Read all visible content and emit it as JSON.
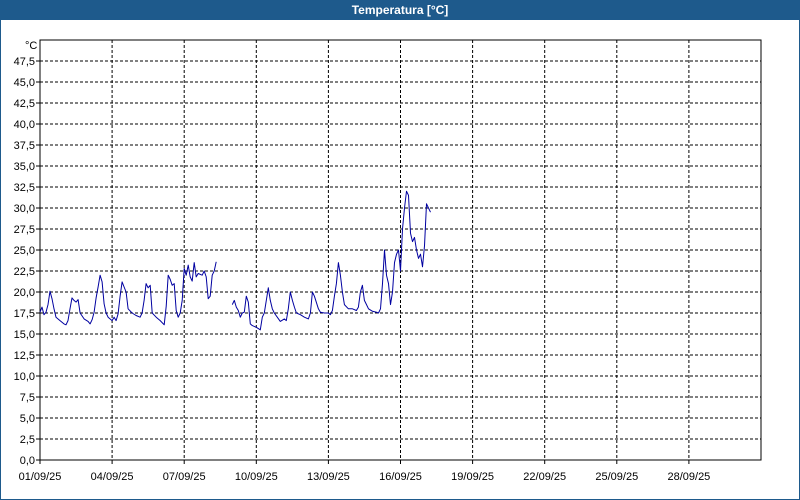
{
  "window": {
    "title": "Temperatura [°C]"
  },
  "colors": {
    "title_bar": "#1e5a8c",
    "series": "#0000a0",
    "grid": "#000000"
  },
  "chart_data": {
    "type": "line",
    "title": "Temperatura [°C]",
    "ylabel": "°C",
    "xlabel": "",
    "ylim": [
      0,
      50
    ],
    "xlim": [
      "01/09/25",
      "01/10/25"
    ],
    "grid": true,
    "grid_style": "dashed",
    "y_ticks": [
      0,
      2.5,
      5,
      7.5,
      10,
      12.5,
      15,
      17.5,
      20,
      22.5,
      25,
      27.5,
      30,
      32.5,
      35,
      37.5,
      40,
      42.5,
      45,
      47.5
    ],
    "y_tick_labels": [
      "0,0",
      "2,5",
      "5,0",
      "7,5",
      "10,0",
      "12,5",
      "15,0",
      "17,5",
      "20,0",
      "22,5",
      "25,0",
      "27,5",
      "30,0",
      "32,5",
      "35,0",
      "37,5",
      "40,0",
      "42,5",
      "45,0",
      "47,5"
    ],
    "x_ticks": [
      "01/09/25",
      "04/09/25",
      "07/09/25",
      "10/09/25",
      "13/09/25",
      "16/09/25",
      "19/09/25",
      "22/09/25",
      "25/09/25",
      "28/09/25"
    ],
    "x_tick_labels": [
      "01/09/25",
      "04/09/25",
      "07/09/25",
      "10/09/25",
      "13/09/25",
      "16/09/25",
      "19/09/25",
      "22/09/25",
      "25/09/25",
      "28/09/25"
    ],
    "series": [
      {
        "segments": [
          [
            [
              "01/09/25 00:00",
              17.6
            ],
            [
              "01/09/25 02:00",
              18.2
            ],
            [
              "01/09/25 04:00",
              17.3
            ],
            [
              "01/09/25 06:00",
              17.6
            ],
            [
              "01/09/25 08:00",
              18.5
            ],
            [
              "01/09/25 10:00",
              20.1
            ],
            [
              "01/09/25 12:00",
              19.2
            ],
            [
              "01/09/25 14:00",
              18.0
            ],
            [
              "01/09/25 16:00",
              17.0
            ],
            [
              "01/09/25 20:00",
              16.6
            ],
            [
              "02/09/25 00:00",
              16.2
            ],
            [
              "02/09/25 02:00",
              16.1
            ],
            [
              "02/09/25 04:00",
              16.6
            ],
            [
              "02/09/25 06:00",
              18.0
            ],
            [
              "02/09/25 08:00",
              19.3
            ],
            [
              "02/09/25 10:00",
              19.0
            ],
            [
              "02/09/25 12:00",
              18.8
            ],
            [
              "02/09/25 14:00",
              19.1
            ],
            [
              "02/09/25 16:00",
              17.5
            ],
            [
              "02/09/25 20:00",
              16.8
            ],
            [
              "03/09/25 00:00",
              16.5
            ],
            [
              "03/09/25 02:00",
              16.2
            ],
            [
              "03/09/25 04:00",
              16.7
            ],
            [
              "03/09/25 06:00",
              17.6
            ],
            [
              "03/09/25 08:00",
              19.3
            ],
            [
              "03/09/25 10:00",
              20.6
            ],
            [
              "03/09/25 12:00",
              22.0
            ],
            [
              "03/09/25 14:00",
              21.2
            ],
            [
              "03/09/25 16:00",
              18.6
            ],
            [
              "03/09/25 18:00",
              17.5
            ],
            [
              "03/09/25 20:00",
              17.0
            ],
            [
              "04/09/25 00:00",
              16.6
            ],
            [
              "04/09/25 02:00",
              17.0
            ],
            [
              "04/09/25 04:00",
              16.6
            ],
            [
              "04/09/25 06:00",
              17.4
            ],
            [
              "04/09/25 08:00",
              19.5
            ],
            [
              "04/09/25 10:00",
              21.2
            ],
            [
              "04/09/25 12:00",
              20.6
            ],
            [
              "04/09/25 14:00",
              20.0
            ],
            [
              "04/09/25 16:00",
              18.0
            ],
            [
              "04/09/25 20:00",
              17.5
            ],
            [
              "05/09/25 00:00",
              17.2
            ],
            [
              "05/09/25 04:00",
              17.0
            ],
            [
              "05/09/25 06:00",
              17.5
            ],
            [
              "05/09/25 08:00",
              19.0
            ],
            [
              "05/09/25 10:00",
              21.0
            ],
            [
              "05/09/25 12:00",
              20.5
            ],
            [
              "05/09/25 14:00",
              20.8
            ],
            [
              "05/09/25 16:00",
              17.5
            ],
            [
              "05/09/25 20:00",
              17.0
            ],
            [
              "06/09/25 00:00",
              16.6
            ],
            [
              "06/09/25 04:00",
              16.1
            ],
            [
              "06/09/25 06:00",
              18.3
            ],
            [
              "06/09/25 08:00",
              22.0
            ],
            [
              "06/09/25 10:00",
              21.5
            ],
            [
              "06/09/25 12:00",
              20.8
            ],
            [
              "06/09/25 14:00",
              21.0
            ],
            [
              "06/09/25 16:00",
              17.8
            ],
            [
              "06/09/25 18:00",
              17.0
            ],
            [
              "06/09/25 20:00",
              17.5
            ],
            [
              "06/09/25 22:00",
              19.0
            ],
            [
              "07/09/25 00:00",
              22.8
            ],
            [
              "07/09/25 02:00",
              22.0
            ],
            [
              "07/09/25 04:00",
              23.2
            ],
            [
              "07/09/25 06:00",
              21.8
            ],
            [
              "07/09/25 08:00",
              21.3
            ],
            [
              "07/09/25 10:00",
              23.5
            ],
            [
              "07/09/25 12:00",
              21.8
            ],
            [
              "07/09/25 14:00",
              22.2
            ],
            [
              "07/09/25 18:00",
              22.0
            ],
            [
              "07/09/25 20:00",
              22.5
            ],
            [
              "07/09/25 22:00",
              21.8
            ],
            [
              "08/09/25 00:00",
              19.2
            ],
            [
              "08/09/25 02:00",
              19.5
            ],
            [
              "08/09/25 04:00",
              22.0
            ],
            [
              "08/09/25 06:00",
              22.5
            ],
            [
              "08/09/25 08:00",
              23.6
            ]
          ],
          [
            [
              "09/09/25 00:00",
              18.5
            ],
            [
              "09/09/25 02:00",
              19.0
            ],
            [
              "09/09/25 04:00",
              18.2
            ],
            [
              "09/09/25 06:00",
              17.8
            ],
            [
              "09/09/25 08:00",
              17.0
            ],
            [
              "09/09/25 10:00",
              17.5
            ],
            [
              "09/09/25 12:00",
              17.6
            ],
            [
              "09/09/25 14:00",
              19.5
            ],
            [
              "09/09/25 16:00",
              18.8
            ],
            [
              "09/09/25 18:00",
              16.2
            ],
            [
              "09/09/25 20:00",
              16.0
            ],
            [
              "10/09/25 00:00",
              15.8
            ],
            [
              "10/09/25 04:00",
              15.5
            ],
            [
              "10/09/25 06:00",
              17.0
            ],
            [
              "10/09/25 08:00",
              17.5
            ],
            [
              "10/09/25 10:00",
              19.0
            ],
            [
              "10/09/25 12:00",
              20.5
            ],
            [
              "10/09/25 14:00",
              19.0
            ],
            [
              "10/09/25 16:00",
              18.0
            ],
            [
              "10/09/25 18:00",
              17.5
            ],
            [
              "11/09/25 00:00",
              16.5
            ],
            [
              "11/09/25 04:00",
              16.8
            ],
            [
              "11/09/25 06:00",
              16.6
            ],
            [
              "11/09/25 08:00",
              18.0
            ],
            [
              "11/09/25 10:00",
              20.0
            ],
            [
              "11/09/25 12:00",
              19.0
            ],
            [
              "11/09/25 14:00",
              18.2
            ],
            [
              "11/09/25 16:00",
              17.5
            ],
            [
              "11/09/25 20:00",
              17.3
            ],
            [
              "12/09/25 00:00",
              17.0
            ],
            [
              "12/09/25 04:00",
              16.8
            ],
            [
              "12/09/25 06:00",
              17.5
            ],
            [
              "12/09/25 08:00",
              20.0
            ],
            [
              "12/09/25 10:00",
              19.5
            ],
            [
              "12/09/25 14:00",
              18.0
            ],
            [
              "12/09/25 16:00",
              17.6
            ],
            [
              "12/09/25 20:00",
              17.5
            ],
            [
              "13/09/25 00:00",
              17.5
            ],
            [
              "13/09/25 02:00",
              17.3
            ],
            [
              "13/09/25 04:00",
              17.8
            ],
            [
              "13/09/25 06:00",
              19.5
            ],
            [
              "13/09/25 08:00",
              21.0
            ],
            [
              "13/09/25 10:00",
              23.5
            ],
            [
              "13/09/25 12:00",
              22.0
            ],
            [
              "13/09/25 14:00",
              20.0
            ],
            [
              "13/09/25 16:00",
              18.5
            ],
            [
              "13/09/25 20:00",
              18.0
            ],
            [
              "14/09/25 00:00",
              18.0
            ],
            [
              "14/09/25 04:00",
              17.8
            ],
            [
              "14/09/25 06:00",
              18.2
            ],
            [
              "14/09/25 08:00",
              20.0
            ],
            [
              "14/09/25 10:00",
              20.8
            ],
            [
              "14/09/25 12:00",
              19.0
            ],
            [
              "14/09/25 14:00",
              18.5
            ],
            [
              "14/09/25 16:00",
              18.0
            ],
            [
              "14/09/25 20:00",
              17.7
            ],
            [
              "15/09/25 00:00",
              17.6
            ],
            [
              "15/09/25 02:00",
              17.5
            ],
            [
              "15/09/25 04:00",
              18.0
            ],
            [
              "15/09/25 06:00",
              21.0
            ],
            [
              "15/09/25 08:00",
              25.0
            ],
            [
              "15/09/25 10:00",
              22.0
            ],
            [
              "15/09/25 12:00",
              21.0
            ],
            [
              "15/09/25 14:00",
              18.5
            ],
            [
              "15/09/25 16:00",
              20.0
            ],
            [
              "15/09/25 18:00",
              23.5
            ],
            [
              "15/09/25 20:00",
              24.5
            ],
            [
              "15/09/25 22:00",
              25.0
            ],
            [
              "16/09/25 00:00",
              22.5
            ],
            [
              "16/09/25 02:00",
              27.5
            ],
            [
              "16/09/25 04:00",
              30.0
            ],
            [
              "16/09/25 06:00",
              32.0
            ],
            [
              "16/09/25 08:00",
              31.5
            ],
            [
              "16/09/25 10:00",
              27.0
            ],
            [
              "16/09/25 12:00",
              26.0
            ],
            [
              "16/09/25 14:00",
              26.5
            ],
            [
              "16/09/25 16:00",
              25.0
            ],
            [
              "16/09/25 18:00",
              24.0
            ],
            [
              "16/09/25 20:00",
              24.5
            ],
            [
              "16/09/25 22:00",
              23.0
            ],
            [
              "17/09/25 00:00",
              25.5
            ],
            [
              "17/09/25 02:00",
              30.5
            ],
            [
              "17/09/25 04:00",
              30.0
            ],
            [
              "17/09/25 06:00",
              29.5
            ]
          ]
        ]
      }
    ]
  }
}
